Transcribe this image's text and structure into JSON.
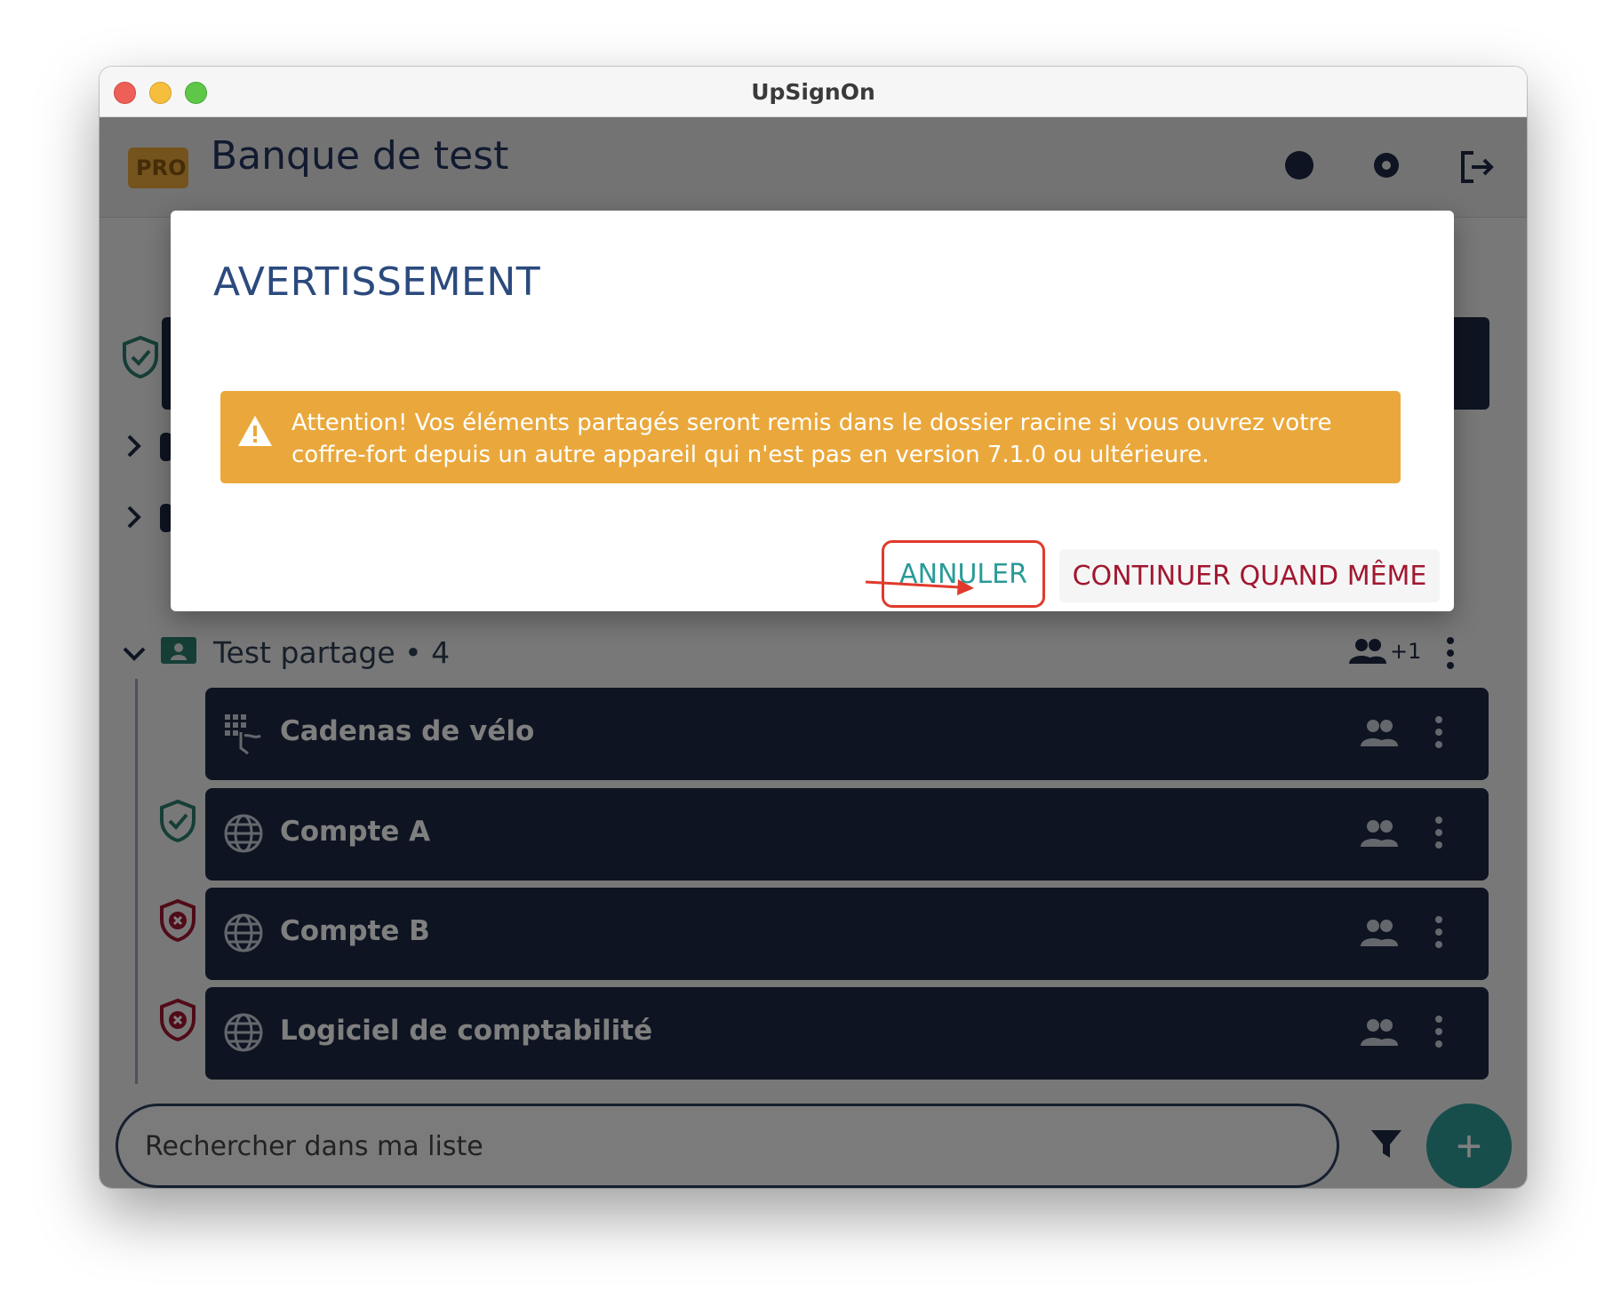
{
  "window": {
    "title": "UpSignOn",
    "buttons": [
      "close",
      "minimize",
      "maximize"
    ]
  },
  "header": {
    "badge": "PRO",
    "bank_name": "Banque de test",
    "icons": [
      "profile-icon",
      "gear-icon",
      "logout-icon"
    ]
  },
  "folder": {
    "name": "Test partage • 4",
    "shared_count": "+1"
  },
  "items": [
    {
      "label": "Cadenas de vélo",
      "icon": "keypad-lock-icon",
      "status": "none"
    },
    {
      "label": "Compte A",
      "icon": "globe-icon",
      "status": "secure"
    },
    {
      "label": "Compte B",
      "icon": "globe-icon",
      "status": "weak"
    },
    {
      "label": "Logiciel de comptabilité",
      "icon": "globe-icon",
      "status": "weak"
    }
  ],
  "search": {
    "placeholder": "Rechercher dans ma liste"
  },
  "fab": {
    "label": "+"
  },
  "dialog": {
    "title": "AVERTISSEMENT",
    "warning": "Attention! Vos éléments partagés seront remis dans le dossier racine si vous ouvrez votre coffre-fort depuis un autre appareil qui n'est pas en version 7.1.0 ou ultérieure.",
    "cancel_label": "ANNULER",
    "continue_label": "CONTINUER QUAND MÊME"
  },
  "colors": {
    "navy": "#1c2942",
    "teal": "#2a9b98",
    "warning": "#eaa83c",
    "danger": "#a11730",
    "highlight": "#e03a2c"
  }
}
